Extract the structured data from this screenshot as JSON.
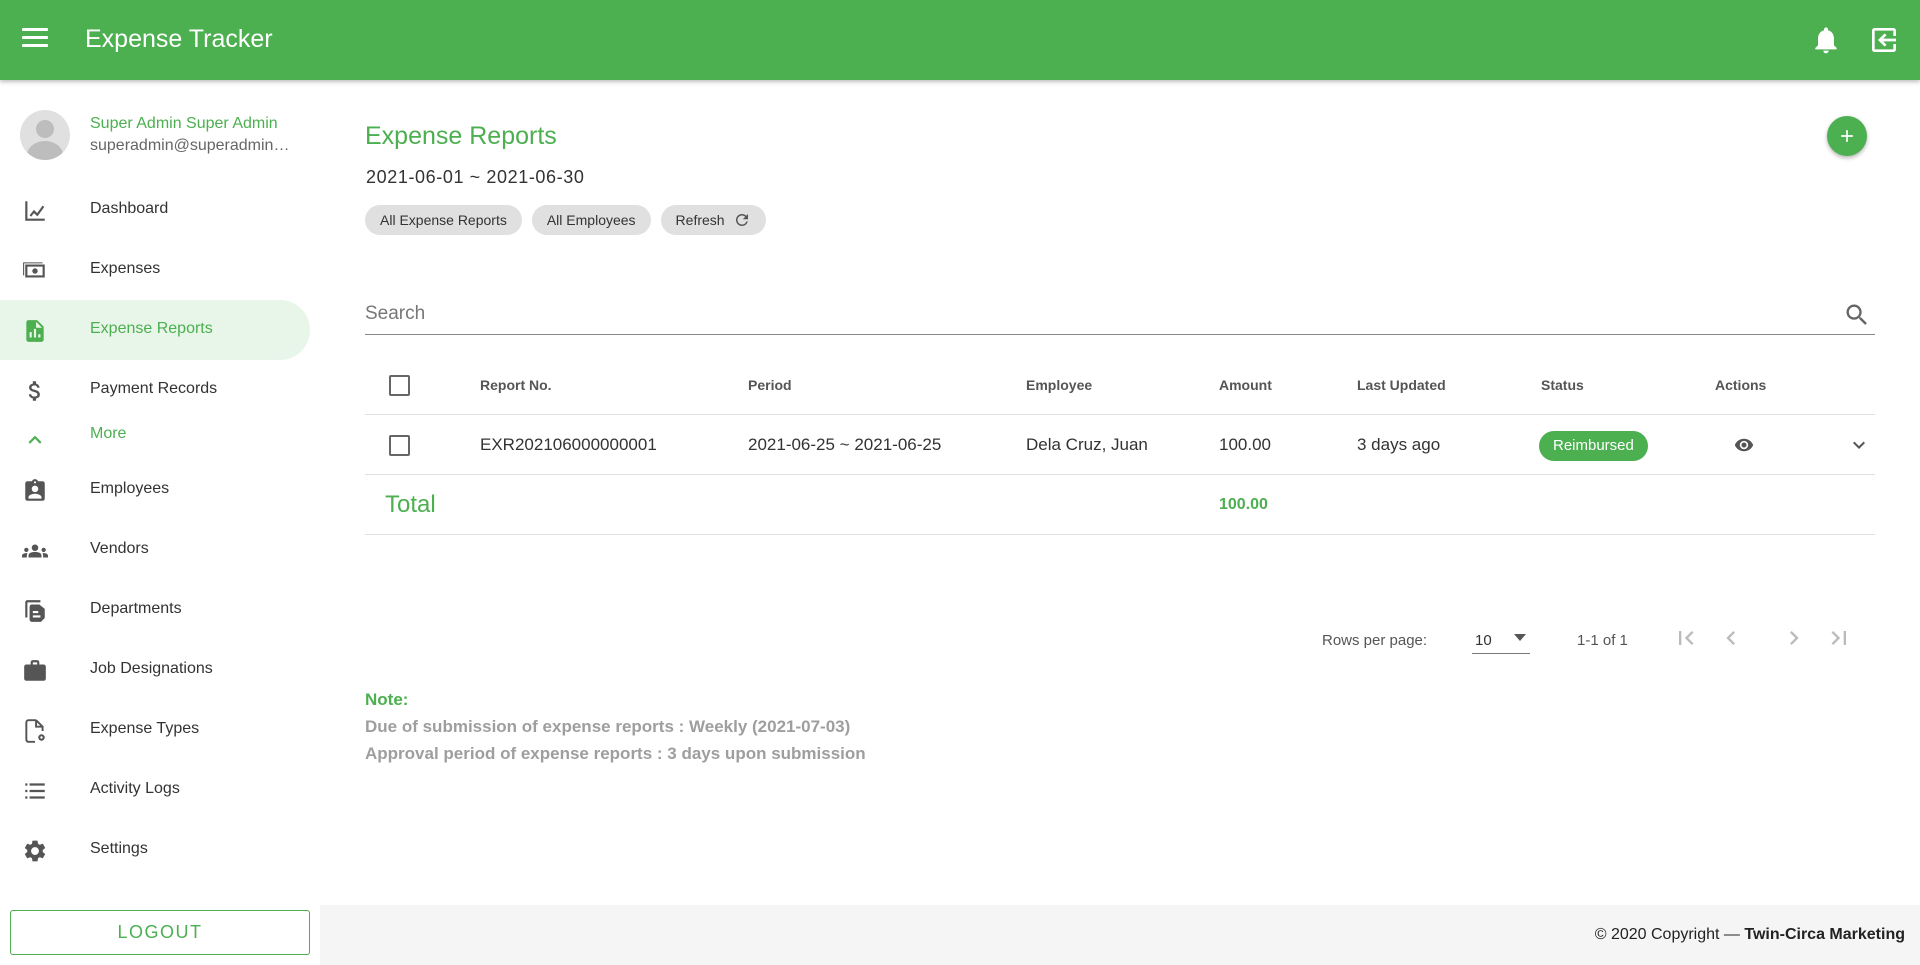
{
  "app": {
    "title": "Expense Tracker"
  },
  "colors": {
    "primary": "#4caf50",
    "active_bg": "#e8f5e9",
    "chip_bg": "#e0e0e0"
  },
  "icons": {
    "menu": "menu-icon",
    "notifications": "bell-icon",
    "exit": "logout-icon"
  },
  "user": {
    "name": "Super Admin Super Admin",
    "email": "superadmin@superadmin.com"
  },
  "sidebar": {
    "items": [
      {
        "label": "Dashboard",
        "icon": "chart-line-icon"
      },
      {
        "label": "Expenses",
        "icon": "cash-icon"
      },
      {
        "label": "Expense Reports",
        "icon": "report-icon",
        "active": true
      },
      {
        "label": "Payment Records",
        "icon": "dollar-icon"
      },
      {
        "label": "More",
        "icon": "chevron-up-icon"
      },
      {
        "label": "Employees",
        "icon": "badge-icon"
      },
      {
        "label": "Vendors",
        "icon": "group-icon"
      },
      {
        "label": "Departments",
        "icon": "clipboard-icon"
      },
      {
        "label": "Job Designations",
        "icon": "briefcase-icon"
      },
      {
        "label": "Expense Types",
        "icon": "file-gear-icon"
      },
      {
        "label": "Activity Logs",
        "icon": "list-icon"
      },
      {
        "label": "Settings",
        "icon": "gear-icon"
      }
    ],
    "logout_label": "LOGOUT"
  },
  "main": {
    "title": "Expense Reports",
    "date_range": "2021-06-01 ~ 2021-06-30",
    "chips": [
      "All Expense Reports",
      "All Employees",
      "Refresh"
    ],
    "search_placeholder": "Search",
    "table": {
      "headers": [
        "Report No.",
        "Period",
        "Employee",
        "Amount",
        "Last Updated",
        "Status",
        "Actions"
      ],
      "rows": [
        {
          "report_no": "EXR202106000000001",
          "period": "2021-06-25 ~ 2021-06-25",
          "employee": "Dela Cruz, Juan",
          "amount": "100.00",
          "last_updated": "3 days ago",
          "status": "Reimbursed"
        }
      ],
      "total_label": "Total",
      "total_amount": "100.00"
    },
    "pagination": {
      "rows_per_page_label": "Rows per page:",
      "rows_per_page": "10",
      "range": "1-1 of 1"
    },
    "note": {
      "title": "Note:",
      "line1": "Due of submission of expense reports : Weekly (2021-07-03)",
      "line2": "Approval period of expense reports : 3 days upon submission"
    }
  },
  "footer": {
    "copyright": "© 2020 Copyright —",
    "company": "Twin-Circa Marketing"
  }
}
